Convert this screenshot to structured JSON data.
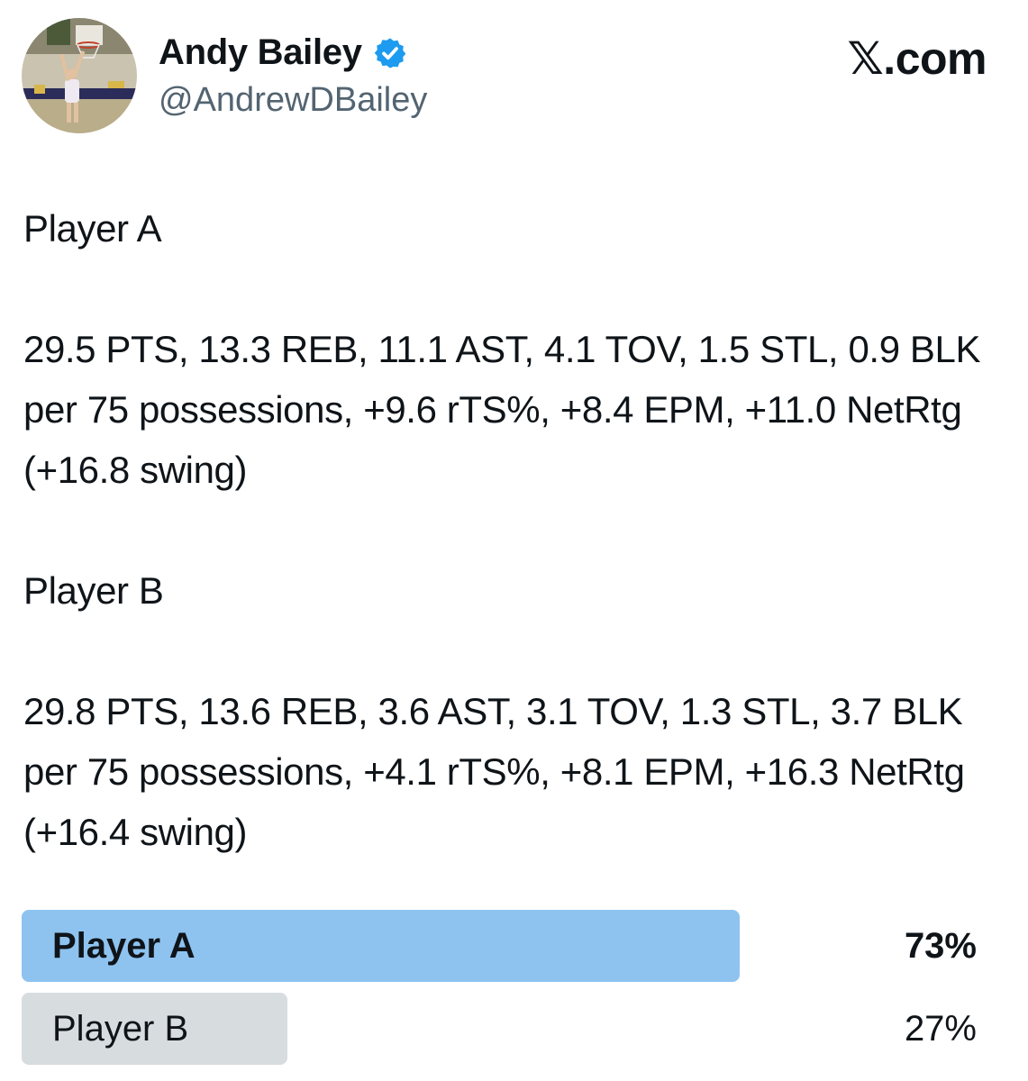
{
  "author": {
    "name": "Andy Bailey",
    "handle": "@AndrewDBailey",
    "verified": true,
    "avatar_icon": "avatar-basketball-photo"
  },
  "brand": {
    "mark": "𝕏",
    "suffix": ".com"
  },
  "tweet": {
    "player_a_heading": "Player A",
    "player_a_stats": "29.5 PTS, 13.3 REB, 11.1 AST, 4.1 TOV, 1.5 STL, 0.9 BLK per 75 possessions, +9.6 rTS%, +8.4 EPM, +11.0 NetRtg (+16.8 swing)",
    "player_b_heading": "Player B",
    "player_b_stats": "29.8 PTS, 13.6 REB, 3.6 AST, 3.1 TOV, 1.3 STL, 3.7 BLK per 75 possessions, +4.1 rTS%, +8.1 EPM, +16.3 NetRtg (+16.4 swing)"
  },
  "poll": {
    "options": [
      {
        "label": "Player A",
        "percent_text": "73%",
        "share": 0.73,
        "winner": true,
        "color": "#8ec3f0"
      },
      {
        "label": "Player B",
        "percent_text": "27%",
        "share": 0.27,
        "winner": false,
        "color": "#d7dcdf"
      }
    ]
  },
  "colors": {
    "text": "#0f1419",
    "secondary_text": "#536471",
    "verified_badge": "#1d9bf0"
  }
}
